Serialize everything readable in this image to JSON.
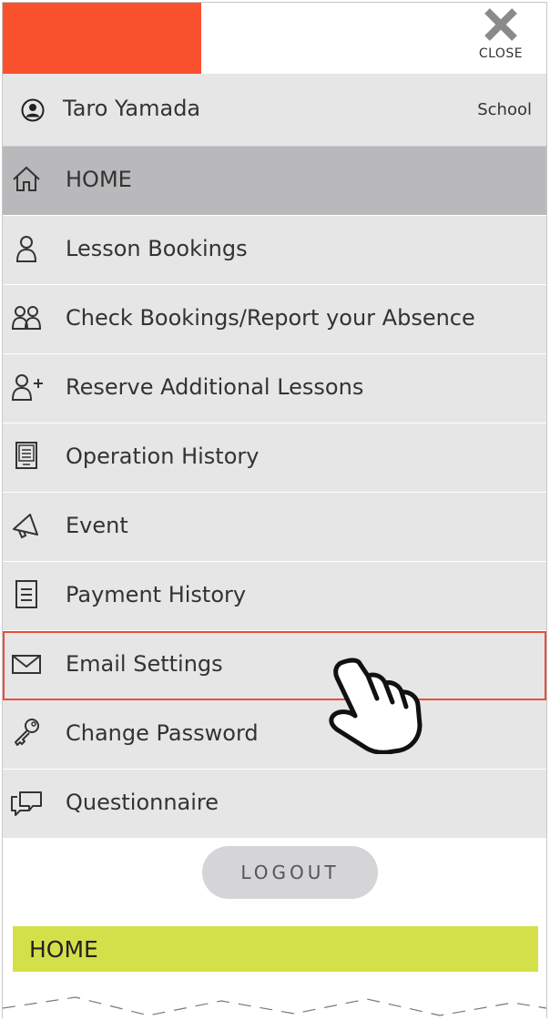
{
  "colors": {
    "brand": "#f9512d",
    "menu_bg": "#e6e6e7",
    "menu_active": "#b9b9bc",
    "highlight_border": "#ea4e3c",
    "banner": "#d4e04a",
    "logout_bg": "#d5d5d8"
  },
  "header": {
    "close_label": "CLOSE",
    "close_icon": "close-x-icon"
  },
  "user": {
    "name": "Taro Yamada",
    "school": "School",
    "icon": "user-circle-icon"
  },
  "menu": {
    "items": [
      {
        "label": "HOME",
        "icon": "home-icon",
        "active": true
      },
      {
        "label": "Lesson Bookings",
        "icon": "person-icon"
      },
      {
        "label": "Check Bookings/Report your Absence",
        "icon": "people-icon"
      },
      {
        "label": "Reserve Additional Lessons",
        "icon": "person-plus-icon"
      },
      {
        "label": "Operation History",
        "icon": "history-board-icon"
      },
      {
        "label": "Event",
        "icon": "megaphone-icon"
      },
      {
        "label": "Payment History",
        "icon": "document-list-icon"
      },
      {
        "label": "Email Settings",
        "icon": "envelope-icon",
        "highlighted": true
      },
      {
        "label": "Change Password",
        "icon": "key-icon"
      },
      {
        "label": "Questionnaire",
        "icon": "speech-bubbles-icon"
      }
    ]
  },
  "logout": {
    "label": "LOGOUT"
  },
  "banner": {
    "label": "HOME"
  }
}
